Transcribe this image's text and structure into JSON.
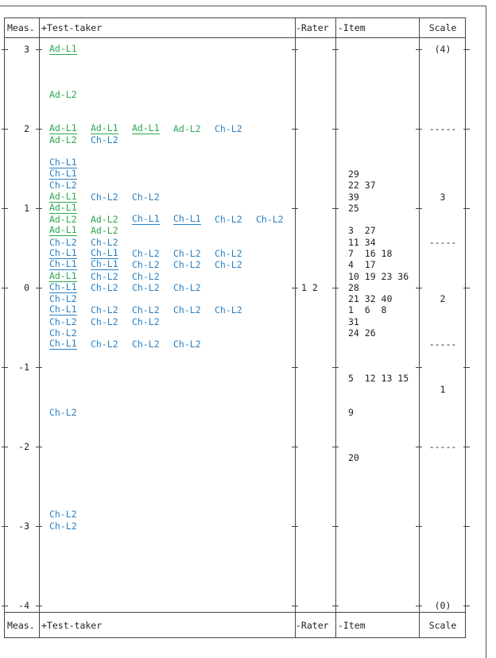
{
  "colors": {
    "Ad": "#2aa84e",
    "Ch": "#2a80c2",
    "text": "#222222"
  },
  "header": {
    "meas": "Meas.",
    "test_taker": "+Test-taker",
    "rater": "-Rater",
    "item": "-Item",
    "scale": "Scale"
  },
  "footer": {
    "meas": "Meas.",
    "test_taker": "+Test-taker",
    "rater": "-Rater",
    "item": "-Item",
    "scale": "Scale"
  },
  "rows": [
    {
      "meas": "3",
      "tt": [
        {
          "t": "Ad-L1",
          "u": true
        }
      ],
      "scale": "(4)"
    },
    {},
    {},
    {},
    {
      "tt": [
        {
          "t": "Ad-L2"
        }
      ]
    },
    {},
    {},
    {
      "meas": "2",
      "tt": [
        {
          "t": "Ad-L1",
          "u": true
        },
        {
          "t": "Ad-L1",
          "u": true
        },
        {
          "t": "Ad-L1",
          "u": true
        },
        {
          "t": "Ad-L2"
        },
        {
          "t": "Ch-L2"
        }
      ],
      "scale": "-----"
    },
    {
      "tt": [
        {
          "t": "Ad-L2"
        },
        {
          "t": "Ch-L2"
        }
      ]
    },
    {},
    {
      "tt": [
        {
          "t": "Ch-L1",
          "u": true
        }
      ]
    },
    {
      "tt": [
        {
          "t": "Ch-L1",
          "u": true
        }
      ],
      "item": "29"
    },
    {
      "tt": [
        {
          "t": "Ch-L2"
        }
      ],
      "item": "22 37"
    },
    {
      "tt": [
        {
          "t": "Ad-L1",
          "u": true
        },
        {
          "t": "Ch-L2"
        },
        {
          "t": "Ch-L2"
        }
      ],
      "item": "39",
      "scale": "3"
    },
    {
      "meas": "1",
      "tt": [
        {
          "t": "Ad-L1",
          "u": true
        }
      ],
      "item": "25"
    },
    {
      "tt": [
        {
          "t": "Ad-L2"
        },
        {
          "t": "Ad-L2"
        },
        {
          "t": "Ch-L1",
          "u": true
        },
        {
          "t": "Ch-L1",
          "u": true
        },
        {
          "t": "Ch-L2"
        },
        {
          "t": "Ch-L2"
        }
      ]
    },
    {
      "tt": [
        {
          "t": "Ad-L1",
          "u": true
        },
        {
          "t": "Ad-L2"
        }
      ],
      "item": "3  27"
    },
    {
      "tt": [
        {
          "t": "Ch-L2"
        },
        {
          "t": "Ch-L2"
        }
      ],
      "item": "11 34",
      "scale": "-----"
    },
    {
      "tt": [
        {
          "t": "Ch-L1",
          "u": true
        },
        {
          "t": "Ch-L1",
          "u": true
        },
        {
          "t": "Ch-L2"
        },
        {
          "t": "Ch-L2"
        },
        {
          "t": "Ch-L2"
        }
      ],
      "item": "7  16 18"
    },
    {
      "tt": [
        {
          "t": "Ch-L1",
          "u": true
        },
        {
          "t": "Ch-L1",
          "u": true
        },
        {
          "t": "Ch-L2"
        },
        {
          "t": "Ch-L2"
        },
        {
          "t": "Ch-L2"
        }
      ],
      "item": "4  17"
    },
    {
      "tt": [
        {
          "t": "Ad-L1",
          "u": true
        },
        {
          "t": "Ch-L2"
        },
        {
          "t": "Ch-L2"
        }
      ],
      "item": "10 19 23 36"
    },
    {
      "meas": "0",
      "tt": [
        {
          "t": "Ch-L1",
          "u": true
        },
        {
          "t": "Ch-L2"
        },
        {
          "t": "Ch-L2"
        },
        {
          "t": "Ch-L2"
        }
      ],
      "rater": "1 2",
      "item": "28"
    },
    {
      "tt": [
        {
          "t": "Ch-L2"
        }
      ],
      "item": "21 32 40",
      "scale": "2"
    },
    {
      "tt": [
        {
          "t": "Ch-L1",
          "u": true
        },
        {
          "t": "Ch-L2"
        },
        {
          "t": "Ch-L2"
        },
        {
          "t": "Ch-L2"
        },
        {
          "t": "Ch-L2"
        }
      ],
      "item": "1  6  8"
    },
    {
      "tt": [
        {
          "t": "Ch-L2"
        },
        {
          "t": "Ch-L2"
        },
        {
          "t": "Ch-L2"
        }
      ],
      "item": "31"
    },
    {
      "tt": [
        {
          "t": "Ch-L2"
        }
      ],
      "item": "24 26"
    },
    {
      "tt": [
        {
          "t": "Ch-L1",
          "u": true
        },
        {
          "t": "Ch-L2"
        },
        {
          "t": "Ch-L2"
        },
        {
          "t": "Ch-L2"
        }
      ],
      "scale": "-----"
    },
    {},
    {
      "meas": "-1"
    },
    {
      "item": "5  12 13 15"
    },
    {
      "scale": "1"
    },
    {},
    {
      "tt": [
        {
          "t": "Ch-L2"
        }
      ],
      "item": "9"
    },
    {},
    {},
    {
      "meas": "-2",
      "scale": "-----"
    },
    {
      "item": "20"
    },
    {},
    {},
    {},
    {},
    {
      "tt": [
        {
          "t": "Ch-L2"
        }
      ]
    },
    {
      "meas": "-3",
      "tt": [
        {
          "t": "Ch-L2"
        }
      ]
    },
    {},
    {},
    {},
    {},
    {},
    {},
    {
      "meas": "-4",
      "scale": "(0)"
    }
  ]
}
